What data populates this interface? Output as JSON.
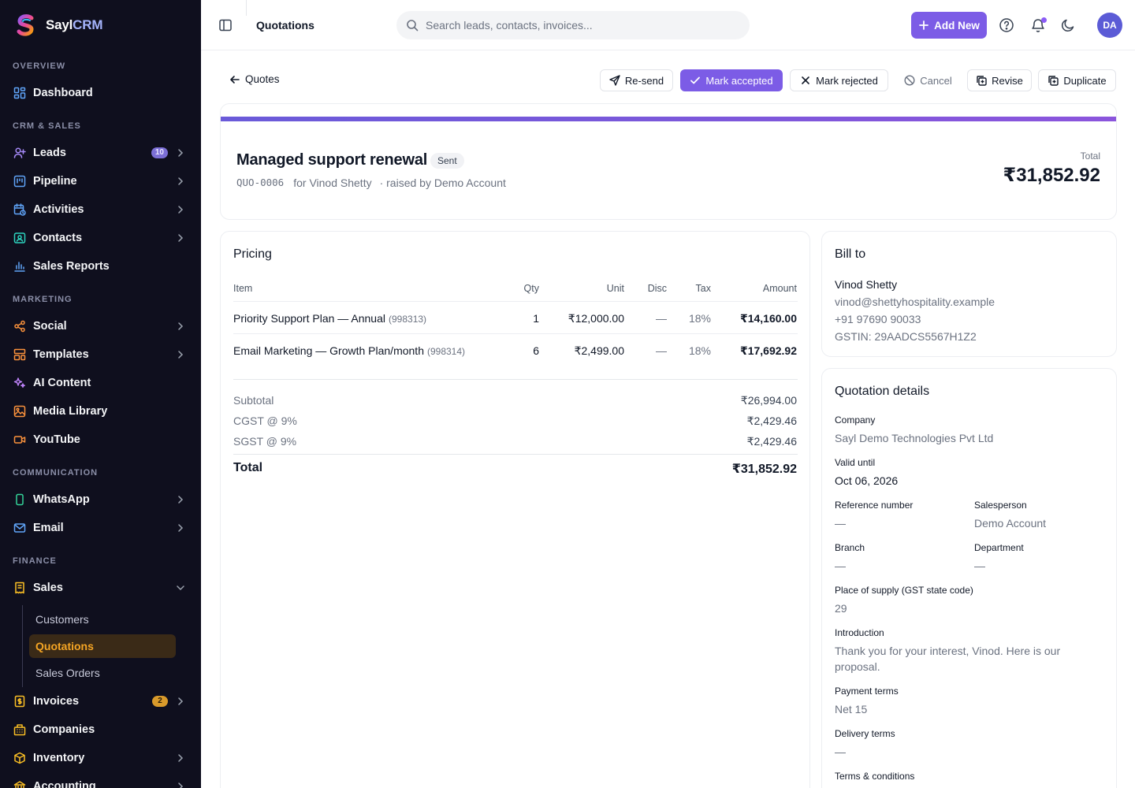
{
  "app": {
    "name_prefix": "Sayl",
    "name_suffix": "CRM"
  },
  "sidebar": {
    "sections": {
      "overview": "OVERVIEW",
      "crm": "CRM & SALES",
      "marketing": "MARKETING",
      "communication": "COMMUNICATION",
      "finance": "FINANCE"
    },
    "items": {
      "dashboard": "Dashboard",
      "leads": "Leads",
      "leads_badge": "10",
      "pipeline": "Pipeline",
      "activities": "Activities",
      "contacts": "Contacts",
      "sales_reports": "Sales Reports",
      "social": "Social",
      "templates": "Templates",
      "ai_content": "AI Content",
      "media_library": "Media Library",
      "youtube": "YouTube",
      "whatsapp": "WhatsApp",
      "email": "Email",
      "sales": "Sales",
      "customers": "Customers",
      "quotations": "Quotations",
      "sales_orders": "Sales Orders",
      "invoices": "Invoices",
      "invoices_badge": "2",
      "companies": "Companies",
      "inventory": "Inventory",
      "accounting": "Accounting"
    }
  },
  "topbar": {
    "title": "Quotations",
    "search_placeholder": "Search leads, contacts, invoices...",
    "add_new": "Add New",
    "avatar": "DA"
  },
  "actions": {
    "back": "Quotes",
    "resend": "Re-send",
    "mark_accepted": "Mark accepted",
    "mark_rejected": "Mark rejected",
    "cancel": "Cancel",
    "revise": "Revise",
    "duplicate": "Duplicate"
  },
  "quote": {
    "title": "Managed support renewal",
    "status": "Sent",
    "number": "QUO-0006",
    "for": "for Vinod Shetty",
    "raised_by": "· raised by Demo Account",
    "total_label": "Total",
    "total": "₹31,852.92"
  },
  "pricing": {
    "heading": "Pricing",
    "columns": {
      "item": "Item",
      "qty": "Qty",
      "unit": "Unit",
      "disc": "Disc",
      "tax": "Tax",
      "amount": "Amount"
    },
    "rows": [
      {
        "item": "Priority Support Plan — Annual",
        "code": "(998313)",
        "qty": "1",
        "unit": "₹12,000.00",
        "disc": "—",
        "tax": "18%",
        "amount": "₹14,160.00"
      },
      {
        "item": "Email Marketing — Growth Plan/month",
        "code": "(998314)",
        "qty": "6",
        "unit": "₹2,499.00",
        "disc": "—",
        "tax": "18%",
        "amount": "₹17,692.92"
      }
    ],
    "subtotal_label": "Subtotal",
    "subtotal": "₹26,994.00",
    "cgst_label": "CGST @ 9%",
    "cgst": "₹2,429.46",
    "sgst_label": "SGST @ 9%",
    "sgst": "₹2,429.46",
    "total_label": "Total",
    "total": "₹31,852.92"
  },
  "bill_to": {
    "heading": "Bill to",
    "name": "Vinod Shetty",
    "email": "vinod@shettyhospitality.example",
    "phone": "+91 97690 90033",
    "gstin": "GSTIN: 29AADCS5567H1Z2"
  },
  "details": {
    "heading": "Quotation details",
    "company_label": "Company",
    "company": "Sayl Demo Technologies Pvt Ltd",
    "valid_label": "Valid until",
    "valid": "Oct 06, 2026",
    "ref_label": "Reference number",
    "ref": "—",
    "salesperson_label": "Salesperson",
    "salesperson": "Demo Account",
    "branch_label": "Branch",
    "branch": "—",
    "department_label": "Department",
    "department": "—",
    "supply_label": "Place of supply (GST state code)",
    "supply": "29",
    "intro_label": "Introduction",
    "intro": "Thank you for your interest, Vinod. Here is our proposal.",
    "payment_label": "Payment terms",
    "payment": "Net 15",
    "delivery_label": "Delivery terms",
    "delivery": "—",
    "tc_label": "Terms & conditions"
  },
  "colors": {
    "accent": "#7c5ce6",
    "sidebar_bg": "#0f0f1e",
    "active_nav": "#f5a524"
  }
}
